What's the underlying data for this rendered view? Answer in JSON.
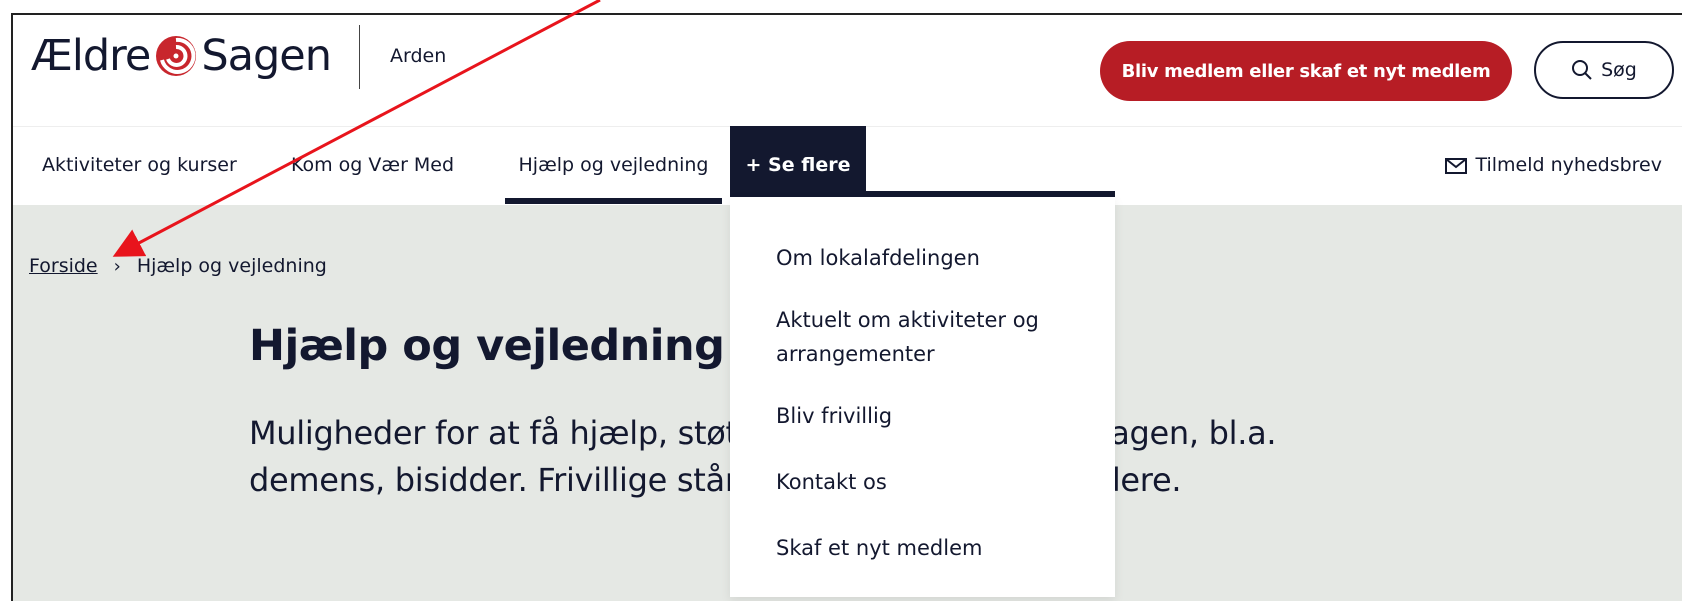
{
  "header": {
    "logo_text_left": "Ældre",
    "logo_text_right": "Sagen",
    "local_name": "Arden",
    "member_button": "Bliv medlem eller skaf et nyt medlem",
    "search_button": "Søg"
  },
  "nav": {
    "items": [
      {
        "label": "Aktiviteter og kurser"
      },
      {
        "label": "Kom og Vær Med"
      },
      {
        "label": "Hjælp og vejledning"
      }
    ],
    "more_label": "+ Se flere",
    "newsletter_label": "Tilmeld nyhedsbrev"
  },
  "dropdown": {
    "items": [
      {
        "label": "Om lokalafdelingen"
      },
      {
        "label": "Aktuelt om aktiviteter og arrangementer"
      },
      {
        "label": "Bliv frivillig"
      },
      {
        "label": "Kontakt os"
      },
      {
        "label": "Skaf et nyt medlem"
      }
    ]
  },
  "breadcrumb": {
    "home": "Forside",
    "current": "Hjælp og vejledning"
  },
  "main": {
    "title": "Hjælp og vejledning",
    "intro_line1": "Muligheder for at få hjælp, støtte og vejledning i hverdagen, bl.a.",
    "intro_line2": "demens, bisidder. Frivillige står klar til at hjælpe dig videre."
  },
  "colors": {
    "brand_red": "#b71d25",
    "navy": "#13182f",
    "main_bg": "#e5e8e4",
    "annotation_arrow": "#e8141c"
  }
}
